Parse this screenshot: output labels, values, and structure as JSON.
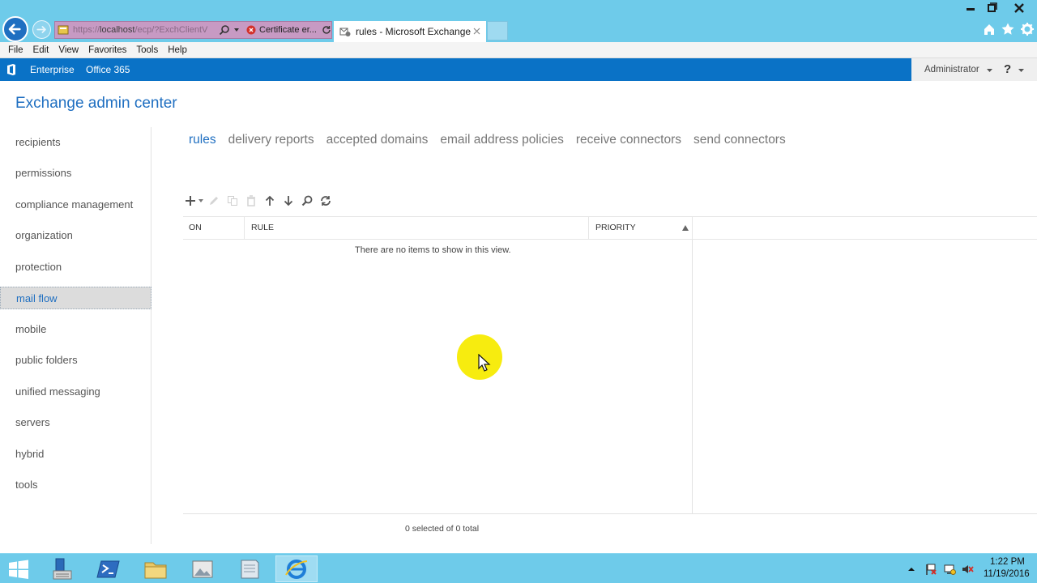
{
  "browser": {
    "address_url_prefix": "https://",
    "address_url_host": "localhost",
    "address_url_path": "/ecp/?ExchClientV",
    "certificate_error_label": "Certificate er...",
    "tab_title": "rules - Microsoft Exchange"
  },
  "menubar": {
    "items": [
      "File",
      "Edit",
      "View",
      "Favorites",
      "Tools",
      "Help"
    ]
  },
  "officebar": {
    "enterprise_label": "Enterprise",
    "office365_label": "Office 365",
    "user_name": "Administrator",
    "help_symbol": "?"
  },
  "eac": {
    "title": "Exchange admin center",
    "nav": [
      {
        "label": "recipients",
        "selected": false
      },
      {
        "label": "permissions",
        "selected": false
      },
      {
        "label": "compliance management",
        "selected": false
      },
      {
        "label": "organization",
        "selected": false
      },
      {
        "label": "protection",
        "selected": false
      },
      {
        "label": "mail flow",
        "selected": true
      },
      {
        "label": "mobile",
        "selected": false
      },
      {
        "label": "public folders",
        "selected": false
      },
      {
        "label": "unified messaging",
        "selected": false
      },
      {
        "label": "servers",
        "selected": false
      },
      {
        "label": "hybrid",
        "selected": false
      },
      {
        "label": "tools",
        "selected": false
      }
    ],
    "subtabs": [
      {
        "label": "rules",
        "active": true
      },
      {
        "label": "delivery reports",
        "active": false
      },
      {
        "label": "accepted domains",
        "active": false
      },
      {
        "label": "email address policies",
        "active": false
      },
      {
        "label": "receive connectors",
        "active": false
      },
      {
        "label": "send connectors",
        "active": false
      }
    ],
    "toolbar_icons": [
      "add-icon",
      "edit-icon",
      "copy-icon",
      "delete-icon",
      "move-up-icon",
      "move-down-icon",
      "search-icon",
      "refresh-icon"
    ],
    "grid": {
      "columns": [
        "ON",
        "RULE",
        "PRIORITY"
      ],
      "empty_message": "There are no items to show in this view.",
      "status": "0 selected of 0 total"
    }
  },
  "taskbar": {
    "time": "1:22 PM",
    "date": "11/19/2016"
  },
  "colors": {
    "accent": "#1f6fc1",
    "office_bar": "#0a72c6",
    "chrome": "#6ecbea",
    "cursor_highlight": "#f7ec0f"
  }
}
